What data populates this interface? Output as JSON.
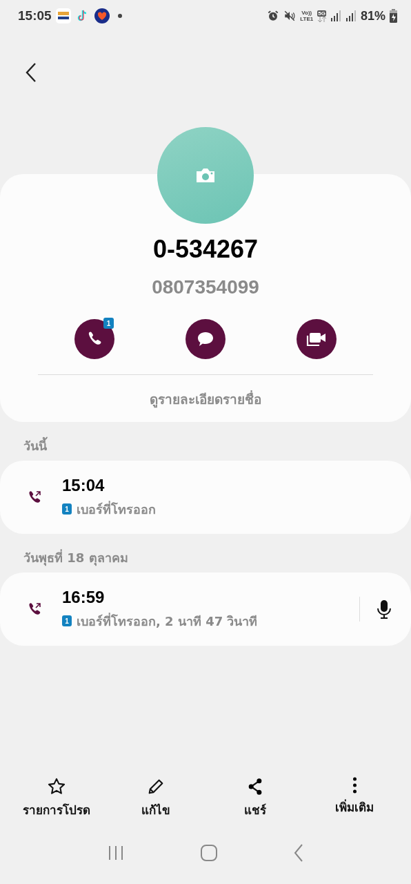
{
  "status_bar": {
    "time": "15:05",
    "volte": "Vo))",
    "lte": "LTE1",
    "network": "5G",
    "battery": "81%"
  },
  "contact": {
    "name": "0-534267",
    "number": "0807354099",
    "call_badge": "1",
    "details_link": "ดูรายละเอียดรายชื่อ"
  },
  "history": [
    {
      "date": "วันนี้",
      "calls": [
        {
          "time": "15:04",
          "sim": "1",
          "detail": "เบอร์ที่โทรออก",
          "recording": false
        }
      ]
    },
    {
      "date": "วันพุธที่ 18 ตุลาคม",
      "calls": [
        {
          "time": "16:59",
          "sim": "1",
          "detail": "เบอร์ที่โทรออก, 2 นาที 47 วินาที",
          "recording": true
        }
      ]
    }
  ],
  "bottom_actions": [
    {
      "kind": "favorite",
      "label": "รายการโปรด"
    },
    {
      "kind": "edit",
      "label": "แก้ไข"
    },
    {
      "kind": "share",
      "label": "แชร์"
    },
    {
      "kind": "more",
      "label": "เพิ่มเติม"
    }
  ]
}
